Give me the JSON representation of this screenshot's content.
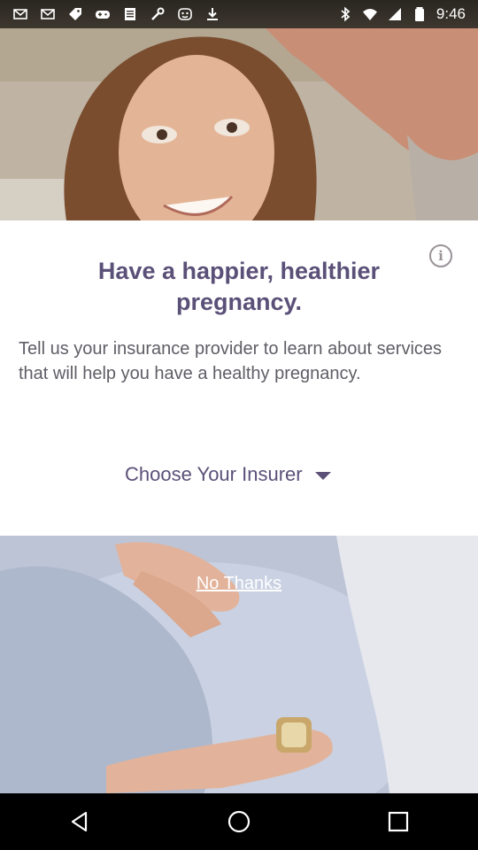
{
  "status_bar": {
    "time": "9:46",
    "left_icons": [
      "mail-icon",
      "mail-icon",
      "tag-icon",
      "game-icon",
      "sheet-icon",
      "tools-icon",
      "face-icon",
      "download-icon"
    ],
    "right_icons": [
      "bluetooth-icon",
      "wifi-icon",
      "signal-icon",
      "battery-icon"
    ]
  },
  "card": {
    "headline": "Have a happier, healthier pregnancy.",
    "description": "Tell us your insurance provider to learn about services that will help you have a healthy pregnancy.",
    "insurer_select_label": "Choose Your Insurer"
  },
  "footer": {
    "no_thanks_label": "No Thanks"
  },
  "nav_bar": {
    "buttons": [
      "back-icon",
      "home-icon",
      "recents-icon"
    ]
  },
  "colors": {
    "accent_purple": "#5b5078",
    "body_text": "#5e5e66",
    "info_icon": "#9a9399",
    "card_bg": "#ffffff"
  }
}
